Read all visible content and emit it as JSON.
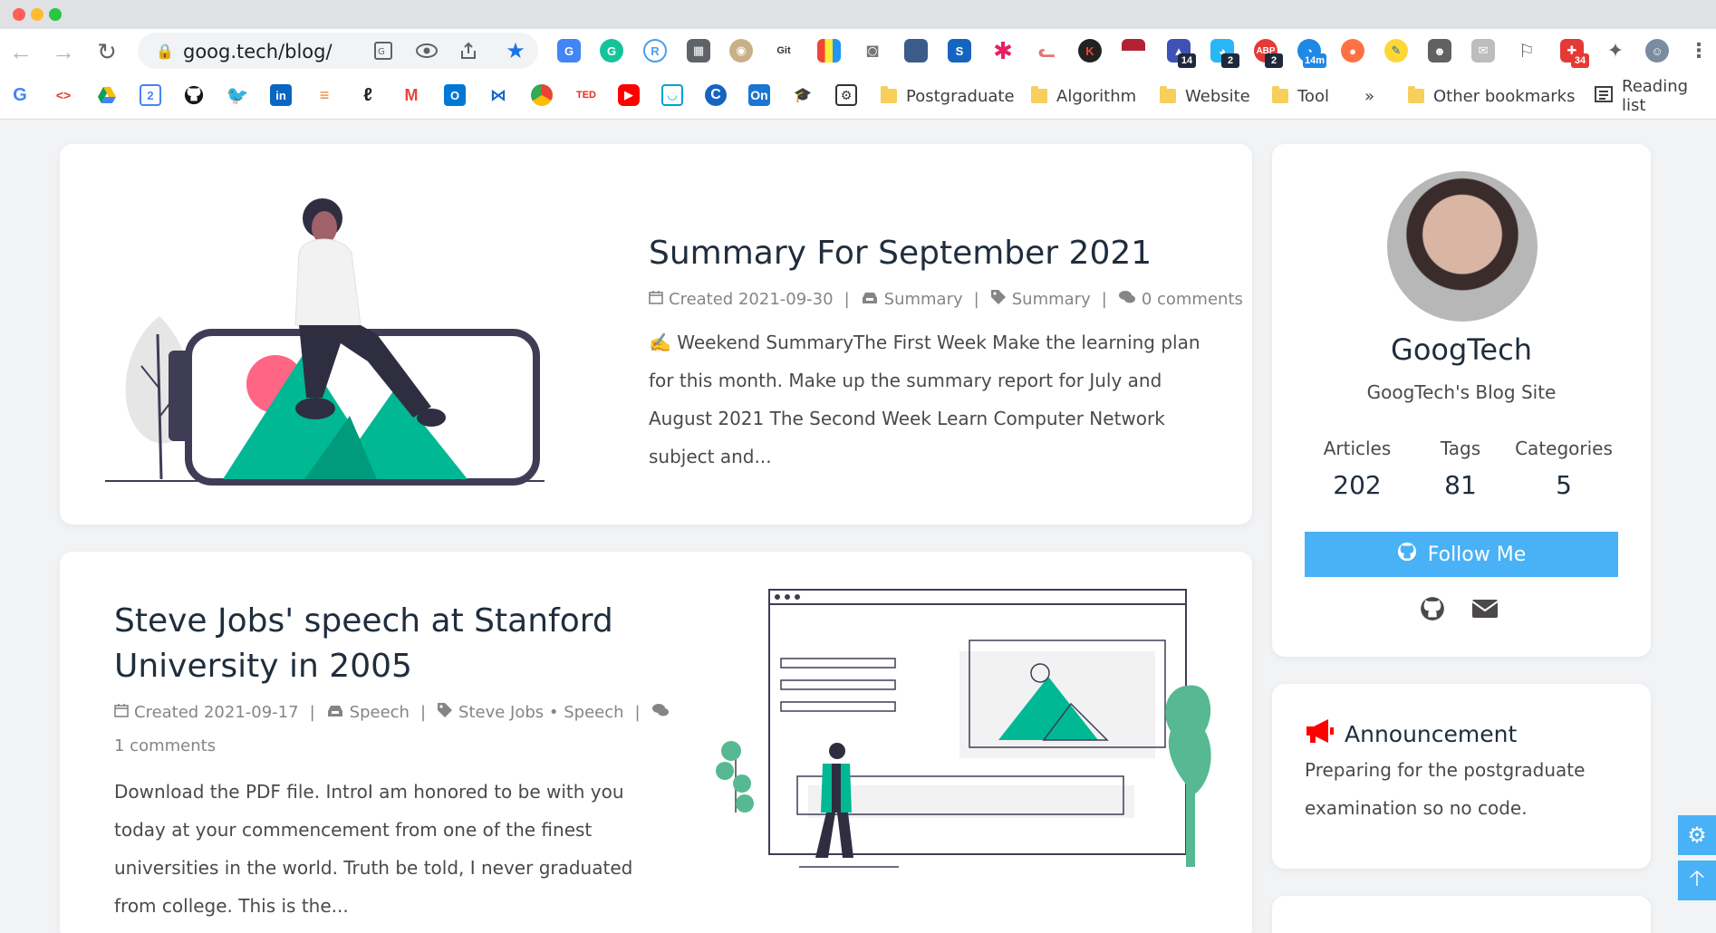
{
  "browser": {
    "url": "goog.tech/blog/",
    "traffic_colors": [
      "#ff5f57",
      "#febc2e",
      "#28c840"
    ],
    "extension_badges": [
      "14",
      "2",
      "2",
      "14m",
      "34"
    ],
    "bookmark_folders": [
      "Postgraduate",
      "Algorithm",
      "Website",
      "Tool"
    ],
    "overflow_label": "»",
    "other_bookmarks": "Other bookmarks",
    "reading_list": "Reading list",
    "bookmark_icons": [
      "google-icon",
      "dev-icon",
      "google-drive-icon",
      "calendar-icon",
      "github-icon",
      "twitter-icon",
      "linkedin-icon",
      "stackoverflow-icon",
      "leetcode-icon",
      "gmail-icon",
      "outlook-icon",
      "microsoft-icon",
      "chrome-icon",
      "ted-icon",
      "youtube-icon",
      "bilibili-icon",
      "c-icon",
      "on-icon",
      "graduation-cap-icon",
      "app-icon"
    ],
    "ted_label": "TED",
    "on_label": "On"
  },
  "posts": [
    {
      "title": "Summary For September 2021",
      "created": "Created 2021-09-30",
      "category": "Summary",
      "tags": "Summary",
      "comments": "0 comments",
      "excerpt": "✍️ Weekend SummaryThe First Week Make the learning plan for this month. Make up the summary report for July and August 2021 The Second Week Learn Computer Network subject and..."
    },
    {
      "title": "Steve Jobs' speech at Stanford University in 2005",
      "created": "Created 2021-09-17",
      "category": "Speech",
      "tags": "Steve Jobs • Speech",
      "comments": "1 comments",
      "excerpt": "Download the PDF file. IntroI am honored to be with you today at your commencement from one of the finest universities in the world. Truth be told, I never graduated from college. This is the..."
    }
  ],
  "author": {
    "name": "GoogTech",
    "description": "GoogTech's Blog Site",
    "stats": [
      {
        "label": "Articles",
        "value": "202"
      },
      {
        "label": "Tags",
        "value": "81"
      },
      {
        "label": "Categories",
        "value": "5"
      }
    ],
    "follow_label": "Follow Me"
  },
  "announcement": {
    "title": "Announcement",
    "text": "Preparing for the postgraduate examination so no code."
  },
  "colors": {
    "accent": "#49b1f5",
    "illustration_green": "#00b894",
    "announcement_red": "#ff0000"
  }
}
